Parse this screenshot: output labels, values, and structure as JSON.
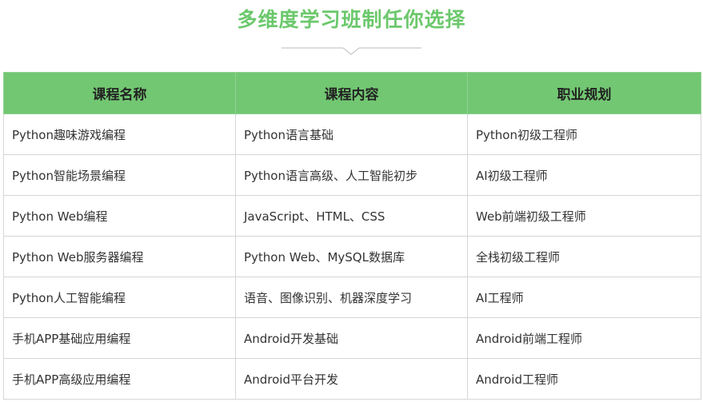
{
  "page": {
    "title": "多维度学习班制任你选择"
  },
  "colors": {
    "accent": "#6cc86c",
    "header_bg": "#72c772",
    "border": "#d6d6d6",
    "divider": "#bbbbbb"
  },
  "table": {
    "headers": [
      "课程名称",
      "课程内容",
      "职业规划"
    ],
    "rows": [
      [
        "Python趣味游戏编程",
        "Python语言基础",
        "Python初级工程师"
      ],
      [
        "Python智能场景编程",
        "Python语言高级、人工智能初步",
        "AI初级工程师"
      ],
      [
        "Python Web编程",
        "JavaScript、HTML、CSS",
        "Web前端初级工程师"
      ],
      [
        "Python Web服务器编程",
        "Python Web、MySQL数据库",
        "全栈初级工程师"
      ],
      [
        "Python人工智能编程",
        "语音、图像识别、机器深度学习",
        "AI工程师"
      ],
      [
        "手机APP基础应用编程",
        "Android开发基础",
        "Android前端工程师"
      ],
      [
        "手机APP高级应用编程",
        "Android平台开发",
        "Android工程师"
      ]
    ]
  }
}
